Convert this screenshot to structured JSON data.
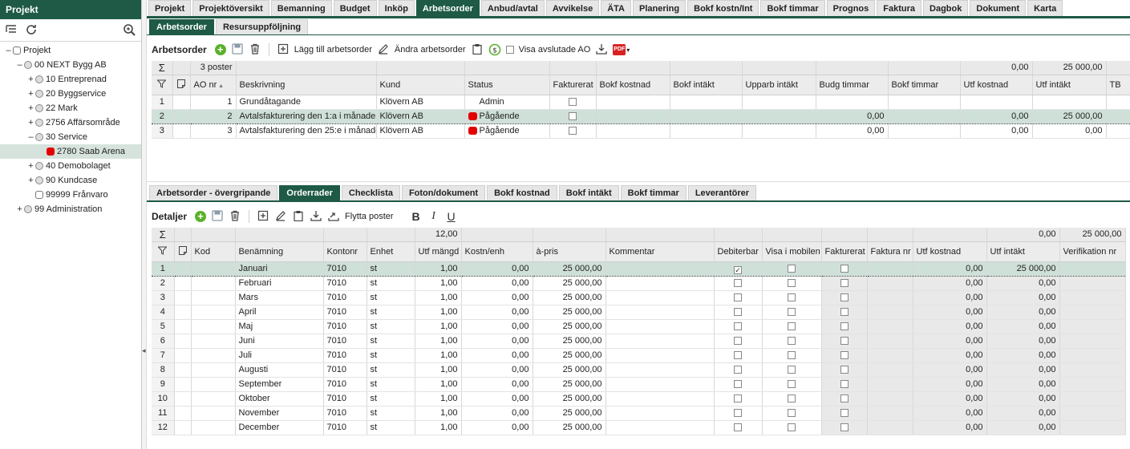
{
  "sidebar": {
    "title": "Projekt",
    "tree": [
      {
        "toggle": "–",
        "label": "Projekt",
        "level": 0,
        "marker": "checkbox"
      },
      {
        "toggle": "–",
        "label": "00 NEXT Bygg AB",
        "level": 1,
        "marker": "round"
      },
      {
        "toggle": "+",
        "label": "10 Entreprenad",
        "level": 2,
        "marker": "round"
      },
      {
        "toggle": "+",
        "label": "20 Byggservice",
        "level": 2,
        "marker": "round"
      },
      {
        "toggle": "+",
        "label": "22 Mark",
        "level": 2,
        "marker": "round"
      },
      {
        "toggle": "+",
        "label": "2756 Affärsområde",
        "level": 2,
        "marker": "round"
      },
      {
        "toggle": "–",
        "label": "30 Service",
        "level": 2,
        "marker": "round"
      },
      {
        "toggle": "",
        "label": "2780 Saab Arena",
        "level": 3,
        "marker": "red",
        "selected": true
      },
      {
        "toggle": "+",
        "label": "40 Demobolaget",
        "level": 2,
        "marker": "round"
      },
      {
        "toggle": "+",
        "label": "90 Kundcase",
        "level": 2,
        "marker": "round"
      },
      {
        "toggle": "",
        "label": "99999 Frånvaro",
        "level": 2,
        "marker": "checkbox"
      },
      {
        "toggle": "+",
        "label": "99 Administration",
        "level": 1,
        "marker": "round"
      }
    ]
  },
  "main_tabs": [
    "Projekt",
    "Projektöversikt",
    "Bemanning",
    "Budget",
    "Inköp",
    "Arbetsorder",
    "Anbud/avtal",
    "Avvikelse",
    "ÄTA",
    "Planering",
    "Bokf kostn/Int",
    "Bokf timmar",
    "Prognos",
    "Faktura",
    "Dagbok",
    "Dokument",
    "Karta"
  ],
  "main_tab_active": "Arbetsorder",
  "sub_tabs": [
    "Arbetsorder",
    "Resursuppföljning"
  ],
  "sub_tab_active": "Arbetsorder",
  "ao_toolbar": {
    "title": "Arbetsorder",
    "add_label": "Lägg till arbetsorder",
    "edit_label": "Ändra arbetsorder",
    "show_closed_label": "Visa avslutade AO",
    "pdf_label": "PDF"
  },
  "ao_grid": {
    "summary": {
      "count": "3 poster",
      "utf_kostnad": "0,00",
      "utf_intakt": "25 000,00"
    },
    "columns": [
      "AO nr",
      "Beskrivning",
      "Kund",
      "Status",
      "Fakturerat",
      "Bokf kostnad",
      "Bokf intäkt",
      "Upparb intäkt",
      "Budg timmar",
      "Bokf timmar",
      "Utf kostnad",
      "Utf intäkt",
      "TB"
    ],
    "rows": [
      {
        "n": "1",
        "ao": "1",
        "desc": "Grundåtagande",
        "kund": "Klövern AB",
        "status": "Admin",
        "dot": false,
        "budg": "",
        "utfk": "",
        "utfi": ""
      },
      {
        "n": "2",
        "ao": "2",
        "desc": "Avtalsfakturering den 1:a i månaden",
        "kund": "Klövern AB",
        "status": "Pågående",
        "dot": true,
        "budg": "0,00",
        "utfk": "0,00",
        "utfi": "25 000,00"
      },
      {
        "n": "3",
        "ao": "3",
        "desc": "Avtalsfakturering den 25:e i månaden",
        "kund": "Klövern AB",
        "status": "Pågående",
        "dot": true,
        "budg": "0,00",
        "utfk": "0,00",
        "utfi": "0,00"
      }
    ]
  },
  "detail_tabs": [
    "Arbetsorder - övergripande",
    "Orderrader",
    "Checklista",
    "Foton/dokument",
    "Bokf kostnad",
    "Bokf intäkt",
    "Bokf timmar",
    "Leverantörer"
  ],
  "detail_tab_active": "Orderrader",
  "detail_toolbar": {
    "title": "Detaljer",
    "move_label": "Flytta poster",
    "bold": "B",
    "italic": "I",
    "underline": "U"
  },
  "detail_grid": {
    "summary": {
      "mangd": "12,00",
      "utf_kostnad": "0,00",
      "utf_intakt": "25 000,00"
    },
    "columns": [
      "Kod",
      "Benämning",
      "Kontonr",
      "Enhet",
      "Utf mängd",
      "Kostn/enh",
      "à-pris",
      "Kommentar",
      "Debiterbar",
      "Visa i mobilen",
      "Fakturerat",
      "Faktura nr",
      "Utf kostnad",
      "Utf intäkt",
      "Verifikation nr"
    ],
    "rows": [
      {
        "n": "1",
        "name": "Januari",
        "konto": "7010",
        "enhet": "st",
        "mangd": "1,00",
        "kostn": "0,00",
        "pris": "25 000,00",
        "deb": true,
        "utfk": "0,00",
        "utfi": "25 000,00"
      },
      {
        "n": "2",
        "name": "Februari",
        "konto": "7010",
        "enhet": "st",
        "mangd": "1,00",
        "kostn": "0,00",
        "pris": "25 000,00",
        "deb": false,
        "utfk": "0,00",
        "utfi": "0,00"
      },
      {
        "n": "3",
        "name": "Mars",
        "konto": "7010",
        "enhet": "st",
        "mangd": "1,00",
        "kostn": "0,00",
        "pris": "25 000,00",
        "deb": false,
        "utfk": "0,00",
        "utfi": "0,00"
      },
      {
        "n": "4",
        "name": "April",
        "konto": "7010",
        "enhet": "st",
        "mangd": "1,00",
        "kostn": "0,00",
        "pris": "25 000,00",
        "deb": false,
        "utfk": "0,00",
        "utfi": "0,00"
      },
      {
        "n": "5",
        "name": "Maj",
        "konto": "7010",
        "enhet": "st",
        "mangd": "1,00",
        "kostn": "0,00",
        "pris": "25 000,00",
        "deb": false,
        "utfk": "0,00",
        "utfi": "0,00"
      },
      {
        "n": "6",
        "name": "Juni",
        "konto": "7010",
        "enhet": "st",
        "mangd": "1,00",
        "kostn": "0,00",
        "pris": "25 000,00",
        "deb": false,
        "utfk": "0,00",
        "utfi": "0,00"
      },
      {
        "n": "7",
        "name": "Juli",
        "konto": "7010",
        "enhet": "st",
        "mangd": "1,00",
        "kostn": "0,00",
        "pris": "25 000,00",
        "deb": false,
        "utfk": "0,00",
        "utfi": "0,00"
      },
      {
        "n": "8",
        "name": "Augusti",
        "konto": "7010",
        "enhet": "st",
        "mangd": "1,00",
        "kostn": "0,00",
        "pris": "25 000,00",
        "deb": false,
        "utfk": "0,00",
        "utfi": "0,00"
      },
      {
        "n": "9",
        "name": "September",
        "konto": "7010",
        "enhet": "st",
        "mangd": "1,00",
        "kostn": "0,00",
        "pris": "25 000,00",
        "deb": false,
        "utfk": "0,00",
        "utfi": "0,00"
      },
      {
        "n": "10",
        "name": "Oktober",
        "konto": "7010",
        "enhet": "st",
        "mangd": "1,00",
        "kostn": "0,00",
        "pris": "25 000,00",
        "deb": false,
        "utfk": "0,00",
        "utfi": "0,00"
      },
      {
        "n": "11",
        "name": "November",
        "konto": "7010",
        "enhet": "st",
        "mangd": "1,00",
        "kostn": "0,00",
        "pris": "25 000,00",
        "deb": false,
        "utfk": "0,00",
        "utfi": "0,00"
      },
      {
        "n": "12",
        "name": "December",
        "konto": "7010",
        "enhet": "st",
        "mangd": "1,00",
        "kostn": "0,00",
        "pris": "25 000,00",
        "deb": false,
        "utfk": "0,00",
        "utfi": "0,00"
      }
    ]
  },
  "colors": {
    "brand": "#1e5a45",
    "status_red": "#e20000",
    "add_green": "#5ab02b",
    "selected_row": "#cfe0d8"
  }
}
